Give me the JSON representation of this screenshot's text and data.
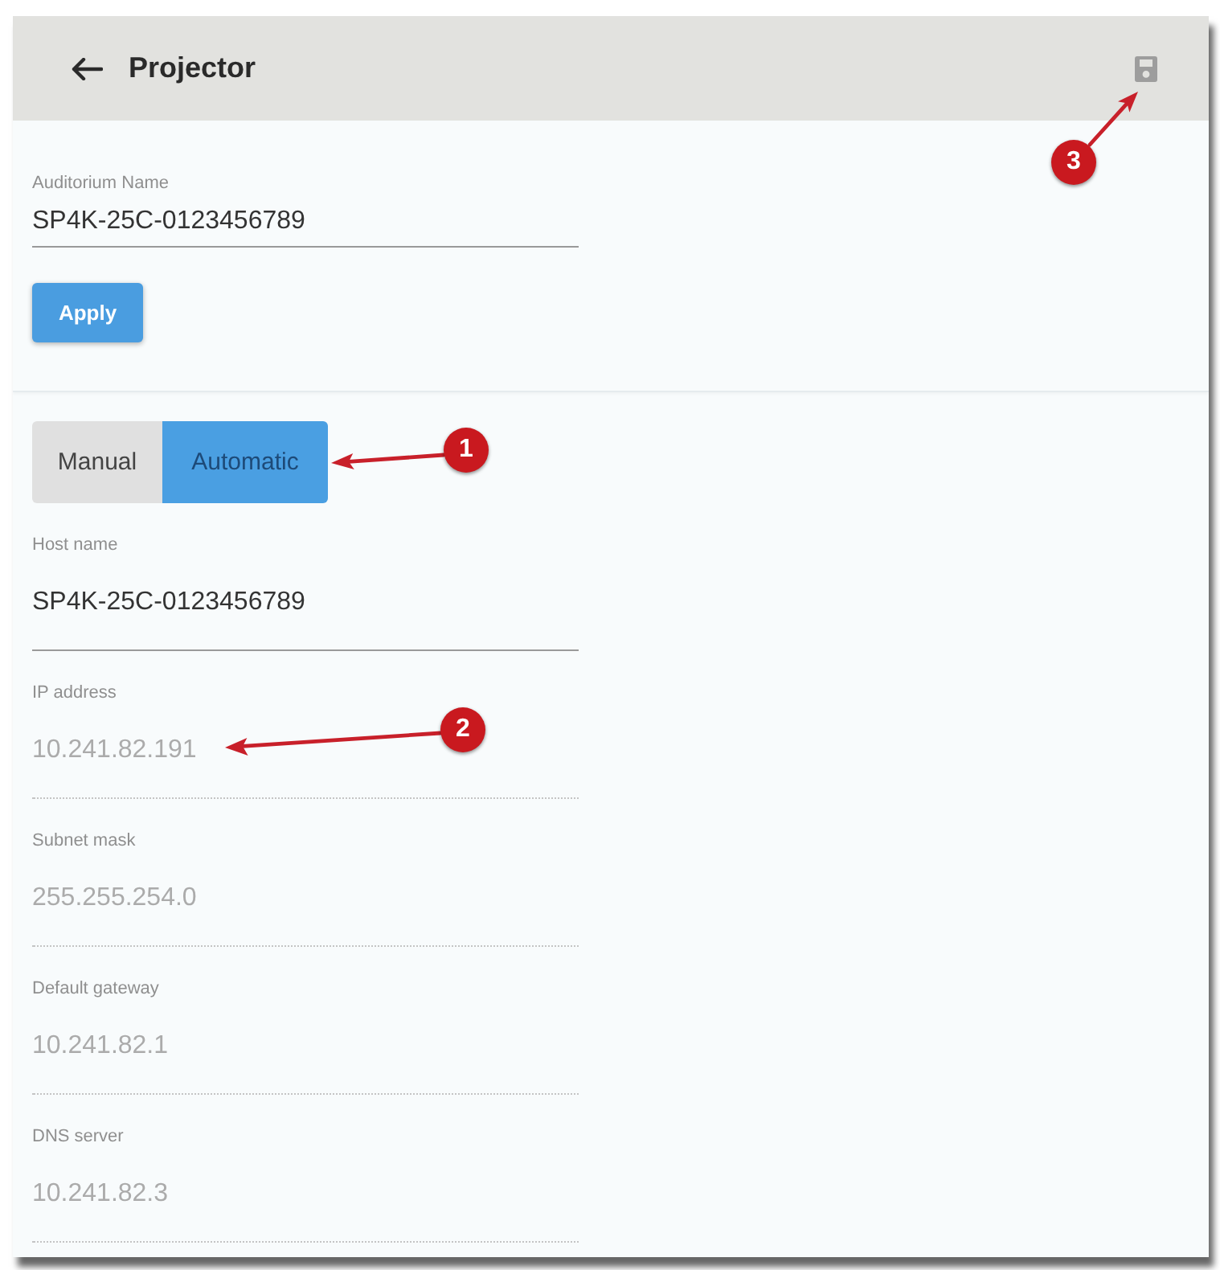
{
  "header": {
    "title": "Projector",
    "save": {
      "disabled": true,
      "callout": "3"
    }
  },
  "auditorium": {
    "label": "Auditorium Name",
    "value": "SP4K-25C-0123456789",
    "button": "Apply"
  },
  "mode": {
    "options": [
      {
        "label": "Manual",
        "selected": false
      },
      {
        "label": "Automatic",
        "selected": true
      }
    ],
    "callout": "1"
  },
  "fields": [
    {
      "label": "Host name",
      "value": "SP4K-25C-0123456789",
      "disabled": false
    },
    {
      "label": "IP address",
      "value": "10.241.82.191",
      "disabled": true,
      "callout": "2"
    },
    {
      "label": "Subnet mask",
      "value": "255.255.254.0",
      "disabled": true
    },
    {
      "label": "Default gateway",
      "value": "10.241.82.1",
      "disabled": true
    },
    {
      "label": "DNS server",
      "value": "10.241.82.3",
      "disabled": true
    }
  ]
}
